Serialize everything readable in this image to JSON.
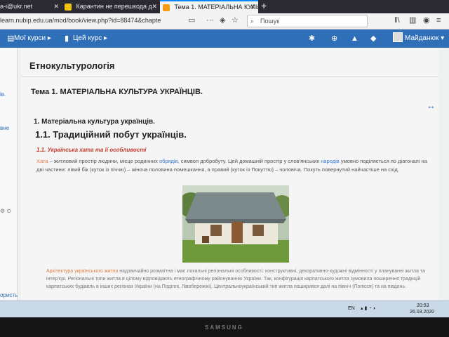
{
  "browser": {
    "tabs": [
      {
        "label": "а-i@ukr.net",
        "active": false
      },
      {
        "label": "Карантин не перешкода д",
        "active": false
      },
      {
        "label": "Тема 1. МАТЕРІАЛЬНА КУЛЬТ",
        "active": true
      }
    ],
    "new_tab": "+",
    "url": "learn.nubip.edu.ua/mod/book/view.php?id=88474&chapte",
    "search_placeholder": "Пошук"
  },
  "moodle_header": {
    "my_courses": "Мої курси",
    "this_course": "Цей курс",
    "user_name": "Майданюк"
  },
  "drawer": {
    "labels": [
      "ів.",
      "вне",
      "ористь"
    ]
  },
  "content": {
    "course_title": "Етнокультурологія",
    "chapter_title": "Тема 1. МАТЕРІАЛЬНА КУЛЬТУРА УКРАЇНЦІВ.",
    "section_h3": "1. Матеріальна культура українців.",
    "section_h2": "1.1. Традиційний побут українців.",
    "subsection": "1.1. Українська хата та її особливості",
    "para_hata": "Хата",
    "para_part1": " – житловий простір людини, місце родинних ",
    "para_link1": "обрядів",
    "para_part2": ", символ добробуту. Цей домашній простір у слов'янських ",
    "para_link2": "народів",
    "para_part3": " умовно поділяється по діагоналі на дві частини: лівий бік (куток із піччю) – жіноча половина помешкання, а правий (куток із Покуттю) – чоловіча. Покуть повернутий найчастіше на схід.",
    "bottom_hl": "Архітектура українського житла",
    "bottom_text": " надзвичайно розмаїтна і має локальні регіональні особливості: конструктивні, декоративно-художні відмінності у плануванні житла та інтер'єрі. Регіональні типи житла в цілому відповідають етнографічному районуванню України. Так, конфігурація карпатського житла зумовила поширення традицій карпатських будівель в інших регіонах України (на Поділлі, Лівобережжі). Центральноукраїнський тип житла поширився далі на північ (Полісся) та на південь."
  },
  "taskbar": {
    "lang": "EN",
    "time": "20:53",
    "date": "26.03.2020"
  },
  "monitor": {
    "brand": "SAMSUNG"
  },
  "colors": {
    "moodle_blue": "#2f6fb8",
    "accent_orange": "#e07a3f",
    "link_blue": "#3a7bd5",
    "subheading_red": "#c0392b"
  }
}
